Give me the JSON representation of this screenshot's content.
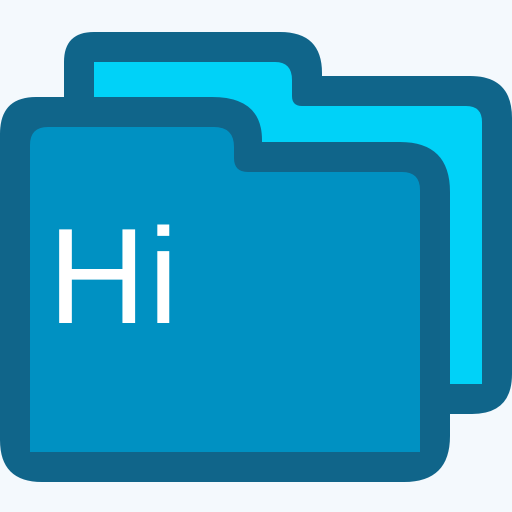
{
  "icon": {
    "name": "folder-icon",
    "label": "Hi",
    "colors": {
      "background": "#f4f9fd",
      "outline": "#10658a",
      "back_folder_fill": "#00d2f8",
      "front_folder_fill": "#0091c2",
      "text": "#ffffff"
    }
  }
}
